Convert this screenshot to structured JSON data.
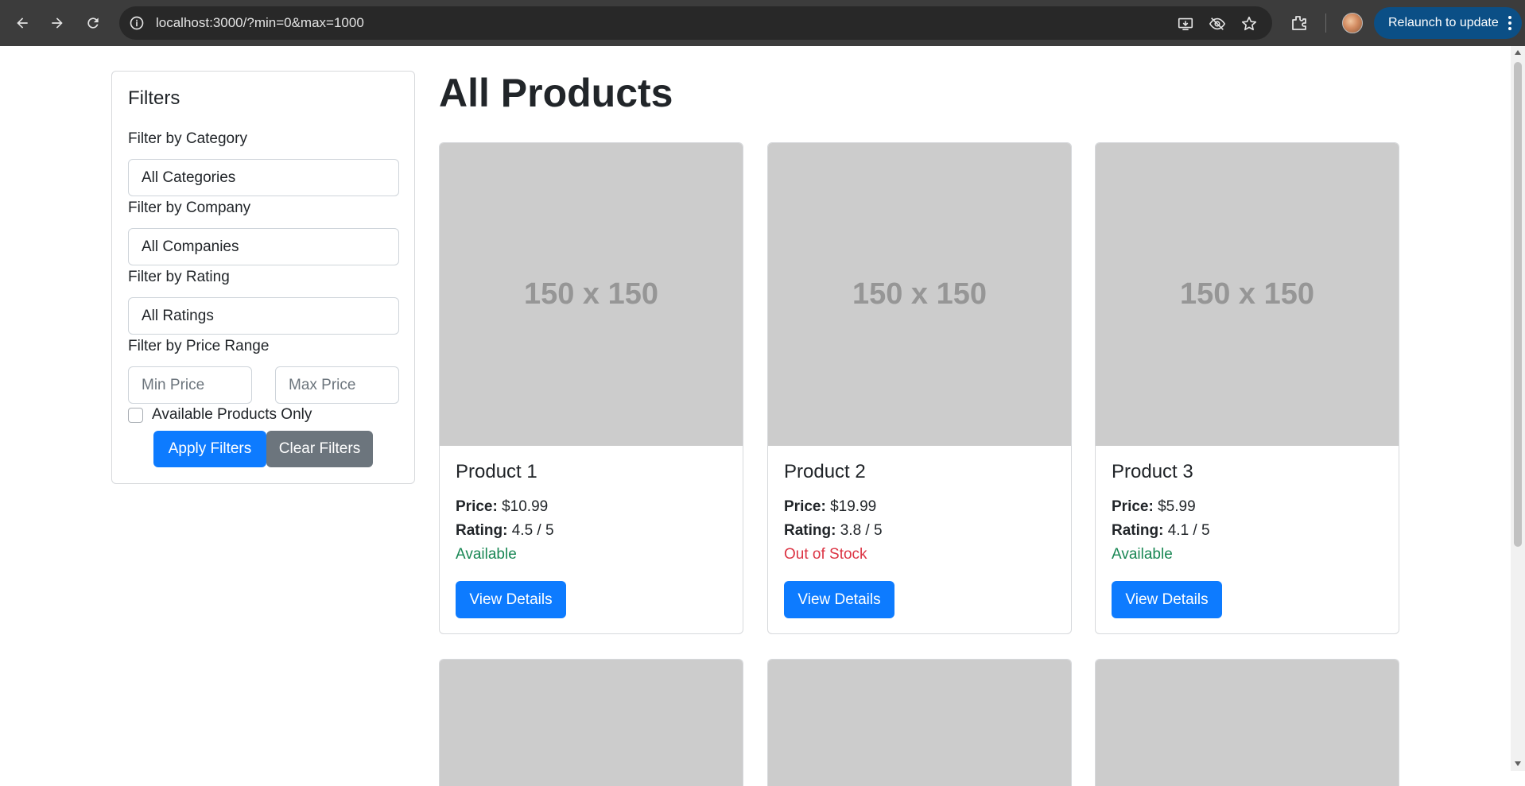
{
  "browser": {
    "url": "localhost:3000/?min=0&max=1000",
    "relaunch_label": "Relaunch to update"
  },
  "filters": {
    "title": "Filters",
    "category_label": "Filter by Category",
    "category_value": "All Categories",
    "company_label": "Filter by Company",
    "company_value": "All Companies",
    "rating_label": "Filter by Rating",
    "rating_value": "All Ratings",
    "price_label": "Filter by Price Range",
    "min_placeholder": "Min Price",
    "max_placeholder": "Max Price",
    "available_label": "Available Products Only",
    "apply_label": "Apply Filters",
    "clear_label": "Clear Filters"
  },
  "main": {
    "title": "All Products",
    "placeholder_text": "150 x 150",
    "price_key": "Price:",
    "rating_key": "Rating:",
    "view_label": "View Details",
    "products": [
      {
        "name": "Product 1",
        "price": "$10.99",
        "rating": "4.5 / 5",
        "status": "Available"
      },
      {
        "name": "Product 2",
        "price": "$19.99",
        "rating": "3.8 / 5",
        "status": "Out of Stock"
      },
      {
        "name": "Product 3",
        "price": "$5.99",
        "rating": "4.1 / 5",
        "status": "Available"
      }
    ]
  },
  "colors": {
    "primary": "#0d7bff",
    "secondary": "#6c757d",
    "available": "#198754",
    "out_of_stock": "#dc3545",
    "placeholder_bg": "#cccccc"
  }
}
